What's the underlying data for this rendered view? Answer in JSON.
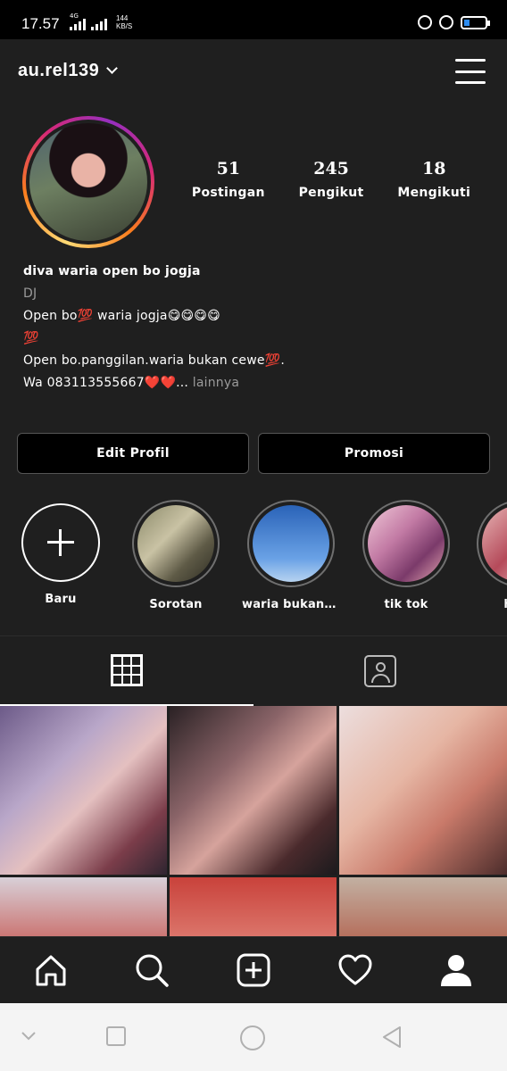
{
  "status_bar": {
    "time": "17.57",
    "network": "4G",
    "speed_value": "144",
    "speed_unit": "KB/S"
  },
  "header": {
    "username": "au.rel139"
  },
  "profile": {
    "stats": [
      {
        "value": "51",
        "label": "Postingan"
      },
      {
        "value": "245",
        "label": "Pengikut"
      },
      {
        "value": "18",
        "label": "Mengikuti"
      }
    ],
    "bio": {
      "name": "diva waria open bo jogja",
      "category": "DJ",
      "line1": "Open bo💯 waria jogja😋😋😋😋",
      "line2": "💯",
      "line3": "Open bo.panggilan.waria bukan cewe💯.",
      "line4": "Wa 083113555667❤️❤️...",
      "more": "lainnya"
    }
  },
  "buttons": {
    "edit_profile": "Edit Profil",
    "promote": "Promosi"
  },
  "highlights": [
    {
      "label": "Baru"
    },
    {
      "label": "Sorotan"
    },
    {
      "label": "waria bukan ce..."
    },
    {
      "label": "tik tok"
    },
    {
      "label": "hijab"
    }
  ],
  "tabs": [
    "grid-icon",
    "tagged-icon"
  ],
  "bottom_nav": [
    "home-icon",
    "search-icon",
    "add-post-icon",
    "activity-heart-icon",
    "profile-icon"
  ],
  "colors": {
    "background": "#1f1f1f",
    "story_ring": [
      "#feda75",
      "#fa7e1e",
      "#d62976",
      "#962fbf"
    ],
    "battery": "#2d8cf0"
  }
}
